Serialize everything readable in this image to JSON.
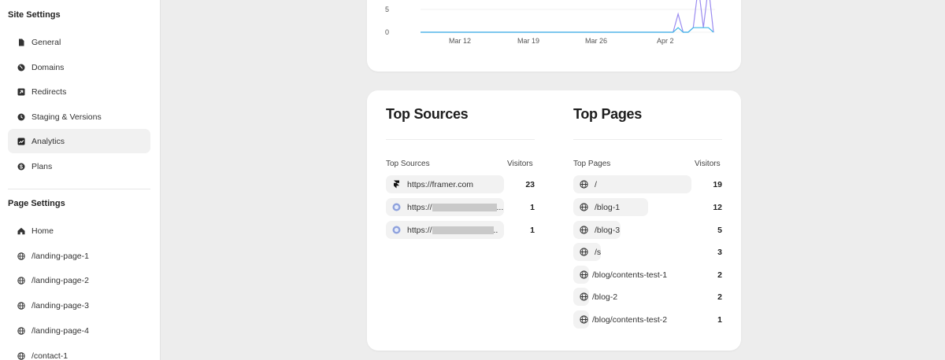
{
  "sidebar": {
    "site_settings_title": "Site Settings",
    "site_items": [
      {
        "label": "General",
        "icon": "file-icon"
      },
      {
        "label": "Domains",
        "icon": "globe-filled-icon"
      },
      {
        "label": "Redirects",
        "icon": "redirect-icon"
      },
      {
        "label": "Staging & Versions",
        "icon": "clock-icon"
      },
      {
        "label": "Analytics",
        "icon": "analytics-icon",
        "active": true
      },
      {
        "label": "Plans",
        "icon": "dollar-icon"
      }
    ],
    "page_settings_title": "Page Settings",
    "page_items": [
      {
        "label": "Home",
        "icon": "home-icon"
      },
      {
        "label": "/landing-page-1",
        "icon": "globe-icon"
      },
      {
        "label": "/landing-page-2",
        "icon": "globe-icon"
      },
      {
        "label": "/landing-page-3",
        "icon": "globe-icon"
      },
      {
        "label": "/landing-page-4",
        "icon": "globe-icon"
      },
      {
        "label": "/contact-1",
        "icon": "globe-icon"
      }
    ]
  },
  "chart_data": {
    "type": "line",
    "y_ticks": [
      "5",
      "0"
    ],
    "x_ticks": [
      "Mar 12",
      "Mar 19",
      "Mar 26",
      "Apr 2"
    ],
    "series": [
      {
        "color": "#9b8cf0",
        "values": [
          0,
          0,
          0,
          0,
          0,
          0,
          0,
          0,
          0,
          0,
          0,
          0,
          0,
          0,
          0,
          0,
          0,
          0,
          0,
          0,
          0,
          0,
          0,
          0,
          0,
          0,
          0,
          0,
          0,
          0,
          0,
          0,
          0,
          0,
          0,
          0,
          0,
          0,
          0,
          0,
          0,
          0,
          0,
          0,
          0,
          0,
          0,
          0,
          0,
          0,
          0,
          4,
          0,
          0,
          1,
          10,
          1,
          10,
          0
        ]
      },
      {
        "color": "#3fb7e6",
        "values": [
          0,
          0,
          0,
          0,
          0,
          0,
          0,
          0,
          0,
          0,
          0,
          0,
          0,
          0,
          0,
          0,
          0,
          0,
          0,
          0,
          0,
          0,
          0,
          0,
          0,
          0,
          0,
          0,
          0,
          0,
          0,
          0,
          0,
          0,
          0,
          0,
          0,
          0,
          0,
          0,
          0,
          0,
          0,
          0,
          0,
          0,
          0,
          0,
          0,
          0,
          0,
          1,
          0,
          0,
          1,
          1,
          1,
          1,
          0
        ]
      }
    ]
  },
  "top_sources": {
    "title": "Top Sources",
    "col_label": "Top Sources",
    "col_value": "Visitors",
    "rows": [
      {
        "label": "https://framer.com",
        "value": "23",
        "icon": "framer-logo-icon"
      },
      {
        "label": "https://",
        "value": "1",
        "icon": "site-favicon-icon",
        "redacted": true,
        "suffix": "..."
      },
      {
        "label": "https://",
        "value": "1",
        "icon": "site-favicon-icon",
        "redacted": true,
        "suffix": ".."
      }
    ]
  },
  "top_pages": {
    "title": "Top Pages",
    "col_label": "Top Pages",
    "col_value": "Visitors",
    "rows": [
      {
        "label": "/",
        "value": "19"
      },
      {
        "label": "/blog-1",
        "value": "12"
      },
      {
        "label": "/blog-3",
        "value": "5"
      },
      {
        "label": "/styleguide",
        "value": "3"
      },
      {
        "label": "/blog/contents-test-1",
        "value": "2"
      },
      {
        "label": "/blog-2",
        "value": "2"
      },
      {
        "label": "/blog/contents-test-2",
        "value": "1"
      }
    ]
  }
}
